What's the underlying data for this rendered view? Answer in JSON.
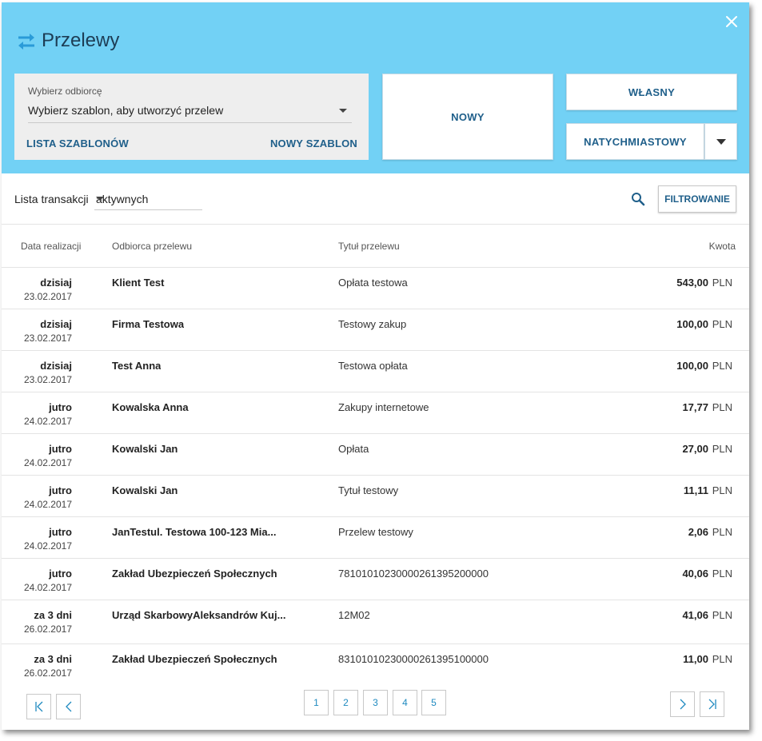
{
  "header": {
    "title": "Przelewy",
    "recipient": {
      "label": "Wybierz odbiorcę",
      "select_value": "Wybierz szablon, aby utworzyć przelew",
      "list_link": "LISTA SZABLONÓW",
      "new_link": "NOWY SZABLON"
    },
    "buttons": {
      "new": "NOWY",
      "own": "WŁASNY",
      "instant": "NATYCHMIASTOWY"
    }
  },
  "toolbar": {
    "list_label": "Lista transakcji",
    "status_value": "aktywnych",
    "filter_label": "FILTROWANIE"
  },
  "table": {
    "headers": {
      "date": "Data realizacji",
      "recipient": "Odbiorca przelewu",
      "title": "Tytuł przelewu",
      "amount": "Kwota"
    },
    "rows": [
      {
        "day": "dzisiaj",
        "date": "23.02.2017",
        "recipient": "Klient Test",
        "title": "Opłata testowa",
        "amount": "543,00",
        "currency": "PLN"
      },
      {
        "day": "dzisiaj",
        "date": "23.02.2017",
        "recipient": "Firma Testowa",
        "title": "Testowy zakup",
        "amount": "100,00",
        "currency": "PLN"
      },
      {
        "day": "dzisiaj",
        "date": "23.02.2017",
        "recipient": "Test Anna",
        "title": "Testowa opłata",
        "amount": "100,00",
        "currency": "PLN"
      },
      {
        "day": "jutro",
        "date": "24.02.2017",
        "recipient": "Kowalska Anna",
        "title": "Zakupy internetowe",
        "amount": "17,77",
        "currency": "PLN"
      },
      {
        "day": "jutro",
        "date": "24.02.2017",
        "recipient": "Kowalski Jan",
        "title": "Opłata",
        "amount": "27,00",
        "currency": "PLN"
      },
      {
        "day": "jutro",
        "date": "24.02.2017",
        "recipient": "Kowalski Jan",
        "title": "Tytuł testowy",
        "amount": "11,11",
        "currency": "PLN"
      },
      {
        "day": "jutro",
        "date": "24.02.2017",
        "recipient": "JanTestul. Testowa 100-123 Mia...",
        "title": "Przelew testowy",
        "amount": "2,06",
        "currency": "PLN"
      },
      {
        "day": "jutro",
        "date": "24.02.2017",
        "recipient": "Zakład Ubezpieczeń Społecznych",
        "title": "78101010230000261395200000",
        "amount": "40,06",
        "currency": "PLN"
      },
      {
        "day": "za 3 dni",
        "date": "26.02.2017",
        "recipient": "Urząd SkarbowyAleksandrów Kuj...",
        "title": "12M02",
        "amount": "41,06",
        "currency": "PLN"
      },
      {
        "day": "za 3 dni",
        "date": "26.02.2017",
        "recipient": "Zakład Ubezpieczeń Społecznych",
        "title": "83101010230000261395100000",
        "amount": "11,00",
        "currency": "PLN"
      }
    ]
  },
  "pagination": {
    "pages": [
      "1",
      "2",
      "3",
      "4",
      "5"
    ]
  },
  "colors": {
    "header_bg": "#72d1f5",
    "accent": "#1f5f8a",
    "icon_blue": "#2a9bd8"
  }
}
